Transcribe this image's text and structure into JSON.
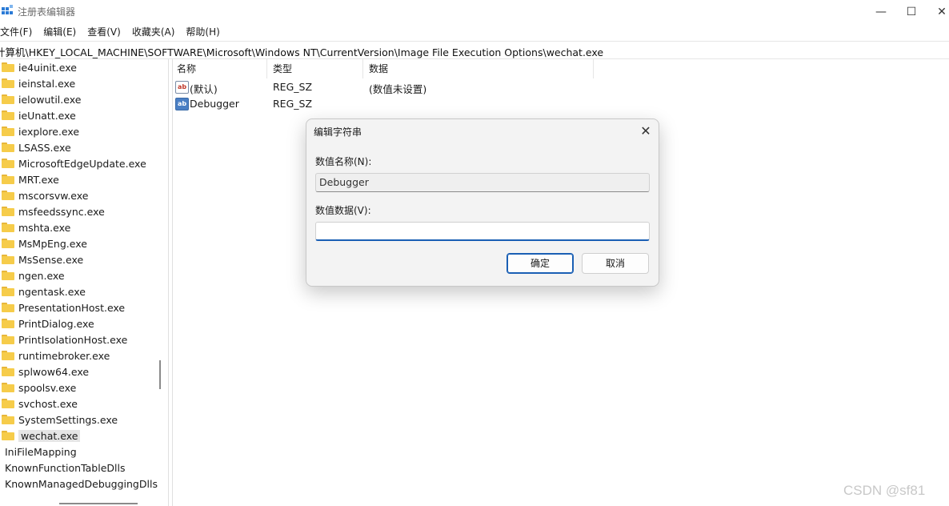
{
  "window": {
    "title": "注册表编辑器",
    "controls": {
      "minimize": "—",
      "maximize": "☐",
      "close": "✕"
    }
  },
  "menu": [
    "文件(F)",
    "编辑(E)",
    "查看(V)",
    "收藏夹(A)",
    "帮助(H)"
  ],
  "address": "计算机\\HKEY_LOCAL_MACHINE\\SOFTWARE\\Microsoft\\Windows NT\\CurrentVersion\\Image File Execution Options\\wechat.exe",
  "tree": [
    {
      "label": "ie4uinit.exe",
      "folder": true
    },
    {
      "label": "ieinstal.exe",
      "folder": true
    },
    {
      "label": "ielowutil.exe",
      "folder": true
    },
    {
      "label": "ieUnatt.exe",
      "folder": true
    },
    {
      "label": "iexplore.exe",
      "folder": true
    },
    {
      "label": "LSASS.exe",
      "folder": true
    },
    {
      "label": "MicrosoftEdgeUpdate.exe",
      "folder": true
    },
    {
      "label": "MRT.exe",
      "folder": true
    },
    {
      "label": "mscorsvw.exe",
      "folder": true
    },
    {
      "label": "msfeedssync.exe",
      "folder": true
    },
    {
      "label": "mshta.exe",
      "folder": true
    },
    {
      "label": "MsMpEng.exe",
      "folder": true
    },
    {
      "label": "MsSense.exe",
      "folder": true
    },
    {
      "label": "ngen.exe",
      "folder": true
    },
    {
      "label": "ngentask.exe",
      "folder": true
    },
    {
      "label": "PresentationHost.exe",
      "folder": true
    },
    {
      "label": "PrintDialog.exe",
      "folder": true
    },
    {
      "label": "PrintIsolationHost.exe",
      "folder": true
    },
    {
      "label": "runtimebroker.exe",
      "folder": true
    },
    {
      "label": "splwow64.exe",
      "folder": true
    },
    {
      "label": "spoolsv.exe",
      "folder": true
    },
    {
      "label": "svchost.exe",
      "folder": true
    },
    {
      "label": "SystemSettings.exe",
      "folder": true
    },
    {
      "label": "wechat.exe",
      "folder": true,
      "selected": true
    },
    {
      "label": "IniFileMapping",
      "folder": false
    },
    {
      "label": "KnownFunctionTableDlls",
      "folder": false
    },
    {
      "label": "KnownManagedDebuggingDlls",
      "folder": false
    }
  ],
  "columns": {
    "name": "名称",
    "type": "类型",
    "data": "数据"
  },
  "values": [
    {
      "icon": "ab",
      "name": "(默认)",
      "type": "REG_SZ",
      "data": "(数值未设置)"
    },
    {
      "icon": "ab",
      "name": "Debugger",
      "type": "REG_SZ",
      "data": ""
    }
  ],
  "dialog": {
    "title": "编辑字符串",
    "close": "✕",
    "name_label": "数值名称(N):",
    "name_value": "Debugger",
    "data_label": "数值数据(V):",
    "data_value": "",
    "ok": "确定",
    "cancel": "取消"
  },
  "watermark": "CSDN @sf81"
}
